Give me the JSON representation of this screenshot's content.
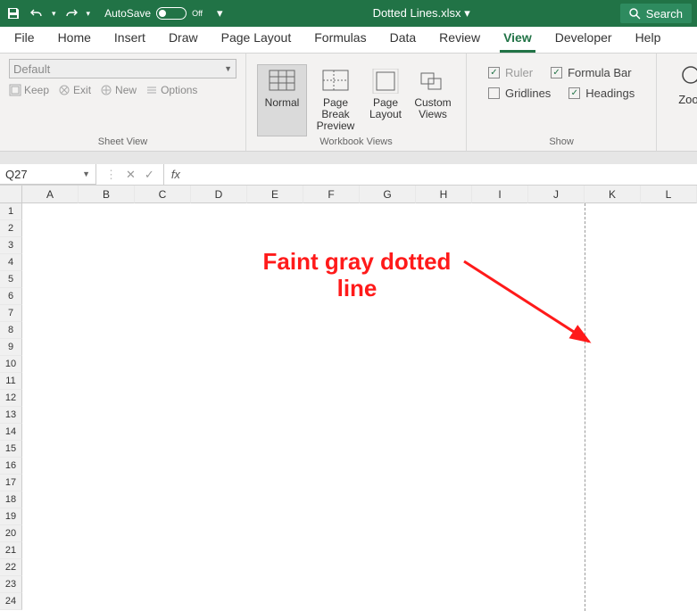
{
  "titlebar": {
    "autosave_label": "AutoSave",
    "autosave_state": "Off",
    "title": "Dotted Lines.xlsx",
    "search_label": "Search"
  },
  "ribbon_tabs": [
    "File",
    "Home",
    "Insert",
    "Draw",
    "Page Layout",
    "Formulas",
    "Data",
    "Review",
    "View",
    "Developer",
    "Help"
  ],
  "active_tab": "View",
  "ribbon": {
    "sheetview": {
      "select_label": "Default",
      "keep": "Keep",
      "exit": "Exit",
      "new": "New",
      "options": "Options",
      "group_label": "Sheet View"
    },
    "workbook_views": {
      "normal": "Normal",
      "page_break": "Page Break Preview",
      "page_layout": "Page Layout",
      "custom": "Custom Views",
      "group_label": "Workbook Views"
    },
    "show": {
      "ruler": "Ruler",
      "formula_bar": "Formula Bar",
      "gridlines": "Gridlines",
      "headings": "Headings",
      "group_label": "Show"
    },
    "zoom": {
      "label": "Zoom"
    }
  },
  "formula_bar": {
    "cell_ref": "Q27",
    "fx": "fx"
  },
  "grid": {
    "columns": [
      "A",
      "B",
      "C",
      "D",
      "E",
      "F",
      "G",
      "H",
      "I",
      "J",
      "K",
      "L"
    ],
    "rows": [
      "1",
      "2",
      "3",
      "4",
      "5",
      "6",
      "7",
      "8",
      "9",
      "10",
      "11",
      "12",
      "13",
      "14",
      "15",
      "16",
      "17",
      "18",
      "19",
      "20",
      "21",
      "22",
      "23",
      "24"
    ],
    "page_break_after_col": "J"
  },
  "annotation": {
    "text_line1": "Faint gray dotted",
    "text_line2": "line"
  }
}
